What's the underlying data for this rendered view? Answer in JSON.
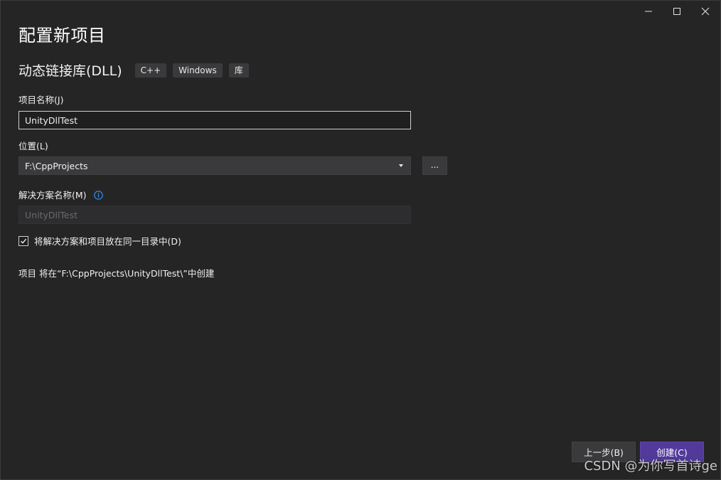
{
  "window": {
    "title": "配置新项目",
    "icons": {
      "minimize": "minimize-icon",
      "maximize": "maximize-icon",
      "close": "close-icon"
    }
  },
  "template": {
    "name": "动态链接库(DLL)",
    "tags": [
      "C++",
      "Windows",
      "库"
    ]
  },
  "project_name": {
    "label": "项目名称(J)",
    "value": "UnityDllTest"
  },
  "location": {
    "label": "位置(L)",
    "value": "F:\\CppProjects",
    "browse_label": "..."
  },
  "solution_name": {
    "label": "解决方案名称(M)",
    "placeholder": "UnityDllTest",
    "info_icon": "info-icon"
  },
  "same_directory": {
    "label": "将解决方案和项目放在同一目录中(D)",
    "checked": true
  },
  "project_path_text": "项目 将在“F:\\CppProjects\\UnityDllTest\\”中创建",
  "footer": {
    "back_label": "上一步(B)",
    "create_label": "创建(C)"
  },
  "watermark": "CSDN @为你写首诗ge",
  "colors": {
    "background": "#252526",
    "accent": "#523a9a",
    "info": "#3794ff"
  }
}
